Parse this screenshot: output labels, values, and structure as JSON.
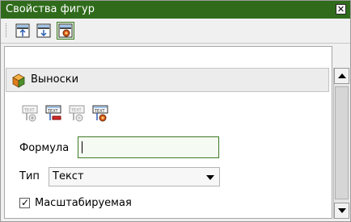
{
  "window": {
    "title": "Свойства фигур",
    "close_glyph": "✕"
  },
  "toolbar": {
    "buttons": [
      {
        "icon": "align-top-icon"
      },
      {
        "icon": "align-bottom-icon"
      },
      {
        "icon": "shape-properties-icon",
        "selected": true
      }
    ]
  },
  "section": {
    "title": "Выноски",
    "icon": "shapes-3d-icon"
  },
  "callout_tools": [
    {
      "icon": "add-callout-icon",
      "enabled": false
    },
    {
      "icon": "remove-callout-icon",
      "enabled": true
    },
    {
      "icon": "callout-settings-icon",
      "enabled": false
    },
    {
      "icon": "callout-properties-icon",
      "enabled": true
    }
  ],
  "form": {
    "formula_label": "Формула",
    "formula_value": "",
    "type_label": "Тип",
    "type_value": "Текст",
    "scalable_label": "Масштабируемая",
    "scalable_checked": true,
    "check_glyph": "✓"
  },
  "colors": {
    "titlebar": "#2f6b1b",
    "accent": "#3d7a24"
  }
}
